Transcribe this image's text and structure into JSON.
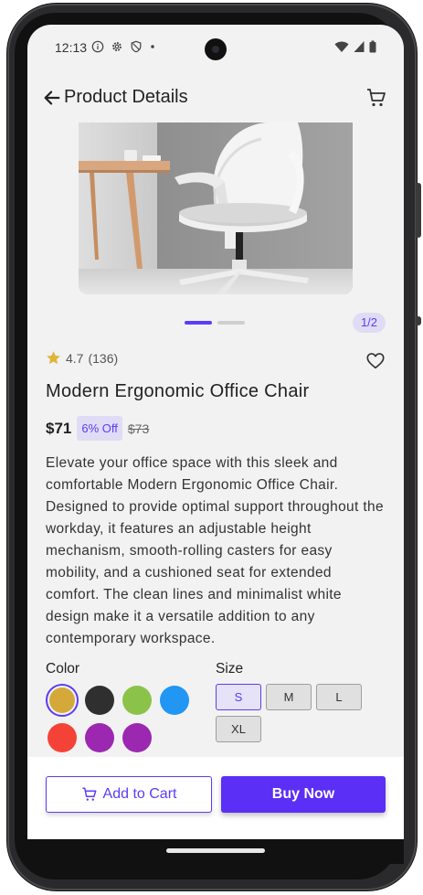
{
  "status_bar": {
    "time": "12:13",
    "icons_left": [
      "info-icon",
      "gear-icon",
      "shield-icon",
      "dot-icon"
    ],
    "icons_right": [
      "wifi-icon",
      "signal-icon",
      "battery-icon"
    ]
  },
  "header": {
    "title": "Product Details",
    "back_icon": "arrow-left-icon",
    "cart_icon": "cart-icon"
  },
  "gallery": {
    "current_page": 1,
    "total_pages": 2,
    "page_indicator": "1/2"
  },
  "product": {
    "rating": "4.7",
    "reviews": "(136)",
    "name": "Modern Ergonomic Office Chair",
    "price": "$71",
    "discount": "6% Off",
    "old_price": "$73",
    "description": "Elevate your office space with this sleek and comfortable Modern Ergonomic Office Chair. Designed to provide optimal support throughout the workday, it features an adjustable height mechanism, smooth-rolling casters for easy mobility, and a cushioned seat for extended comfort. The clean lines and minimalist white design make it a versatile addition to any contemporary workspace."
  },
  "options": {
    "color_label": "Color",
    "size_label": "Size",
    "colors": [
      "#d4a93a",
      "#2f2f2f",
      "#8bc34a",
      "#2196f3",
      "#f44336",
      "#9c27b0",
      "#9c27b0"
    ],
    "selected_color_index": 0,
    "sizes": [
      "S",
      "M",
      "L",
      "XL"
    ],
    "selected_size": "S"
  },
  "actions": {
    "add_to_cart": "Add to Cart",
    "buy_now": "Buy Now"
  },
  "theme": {
    "accent": "#5b3df5",
    "star": "#e0b53a"
  }
}
